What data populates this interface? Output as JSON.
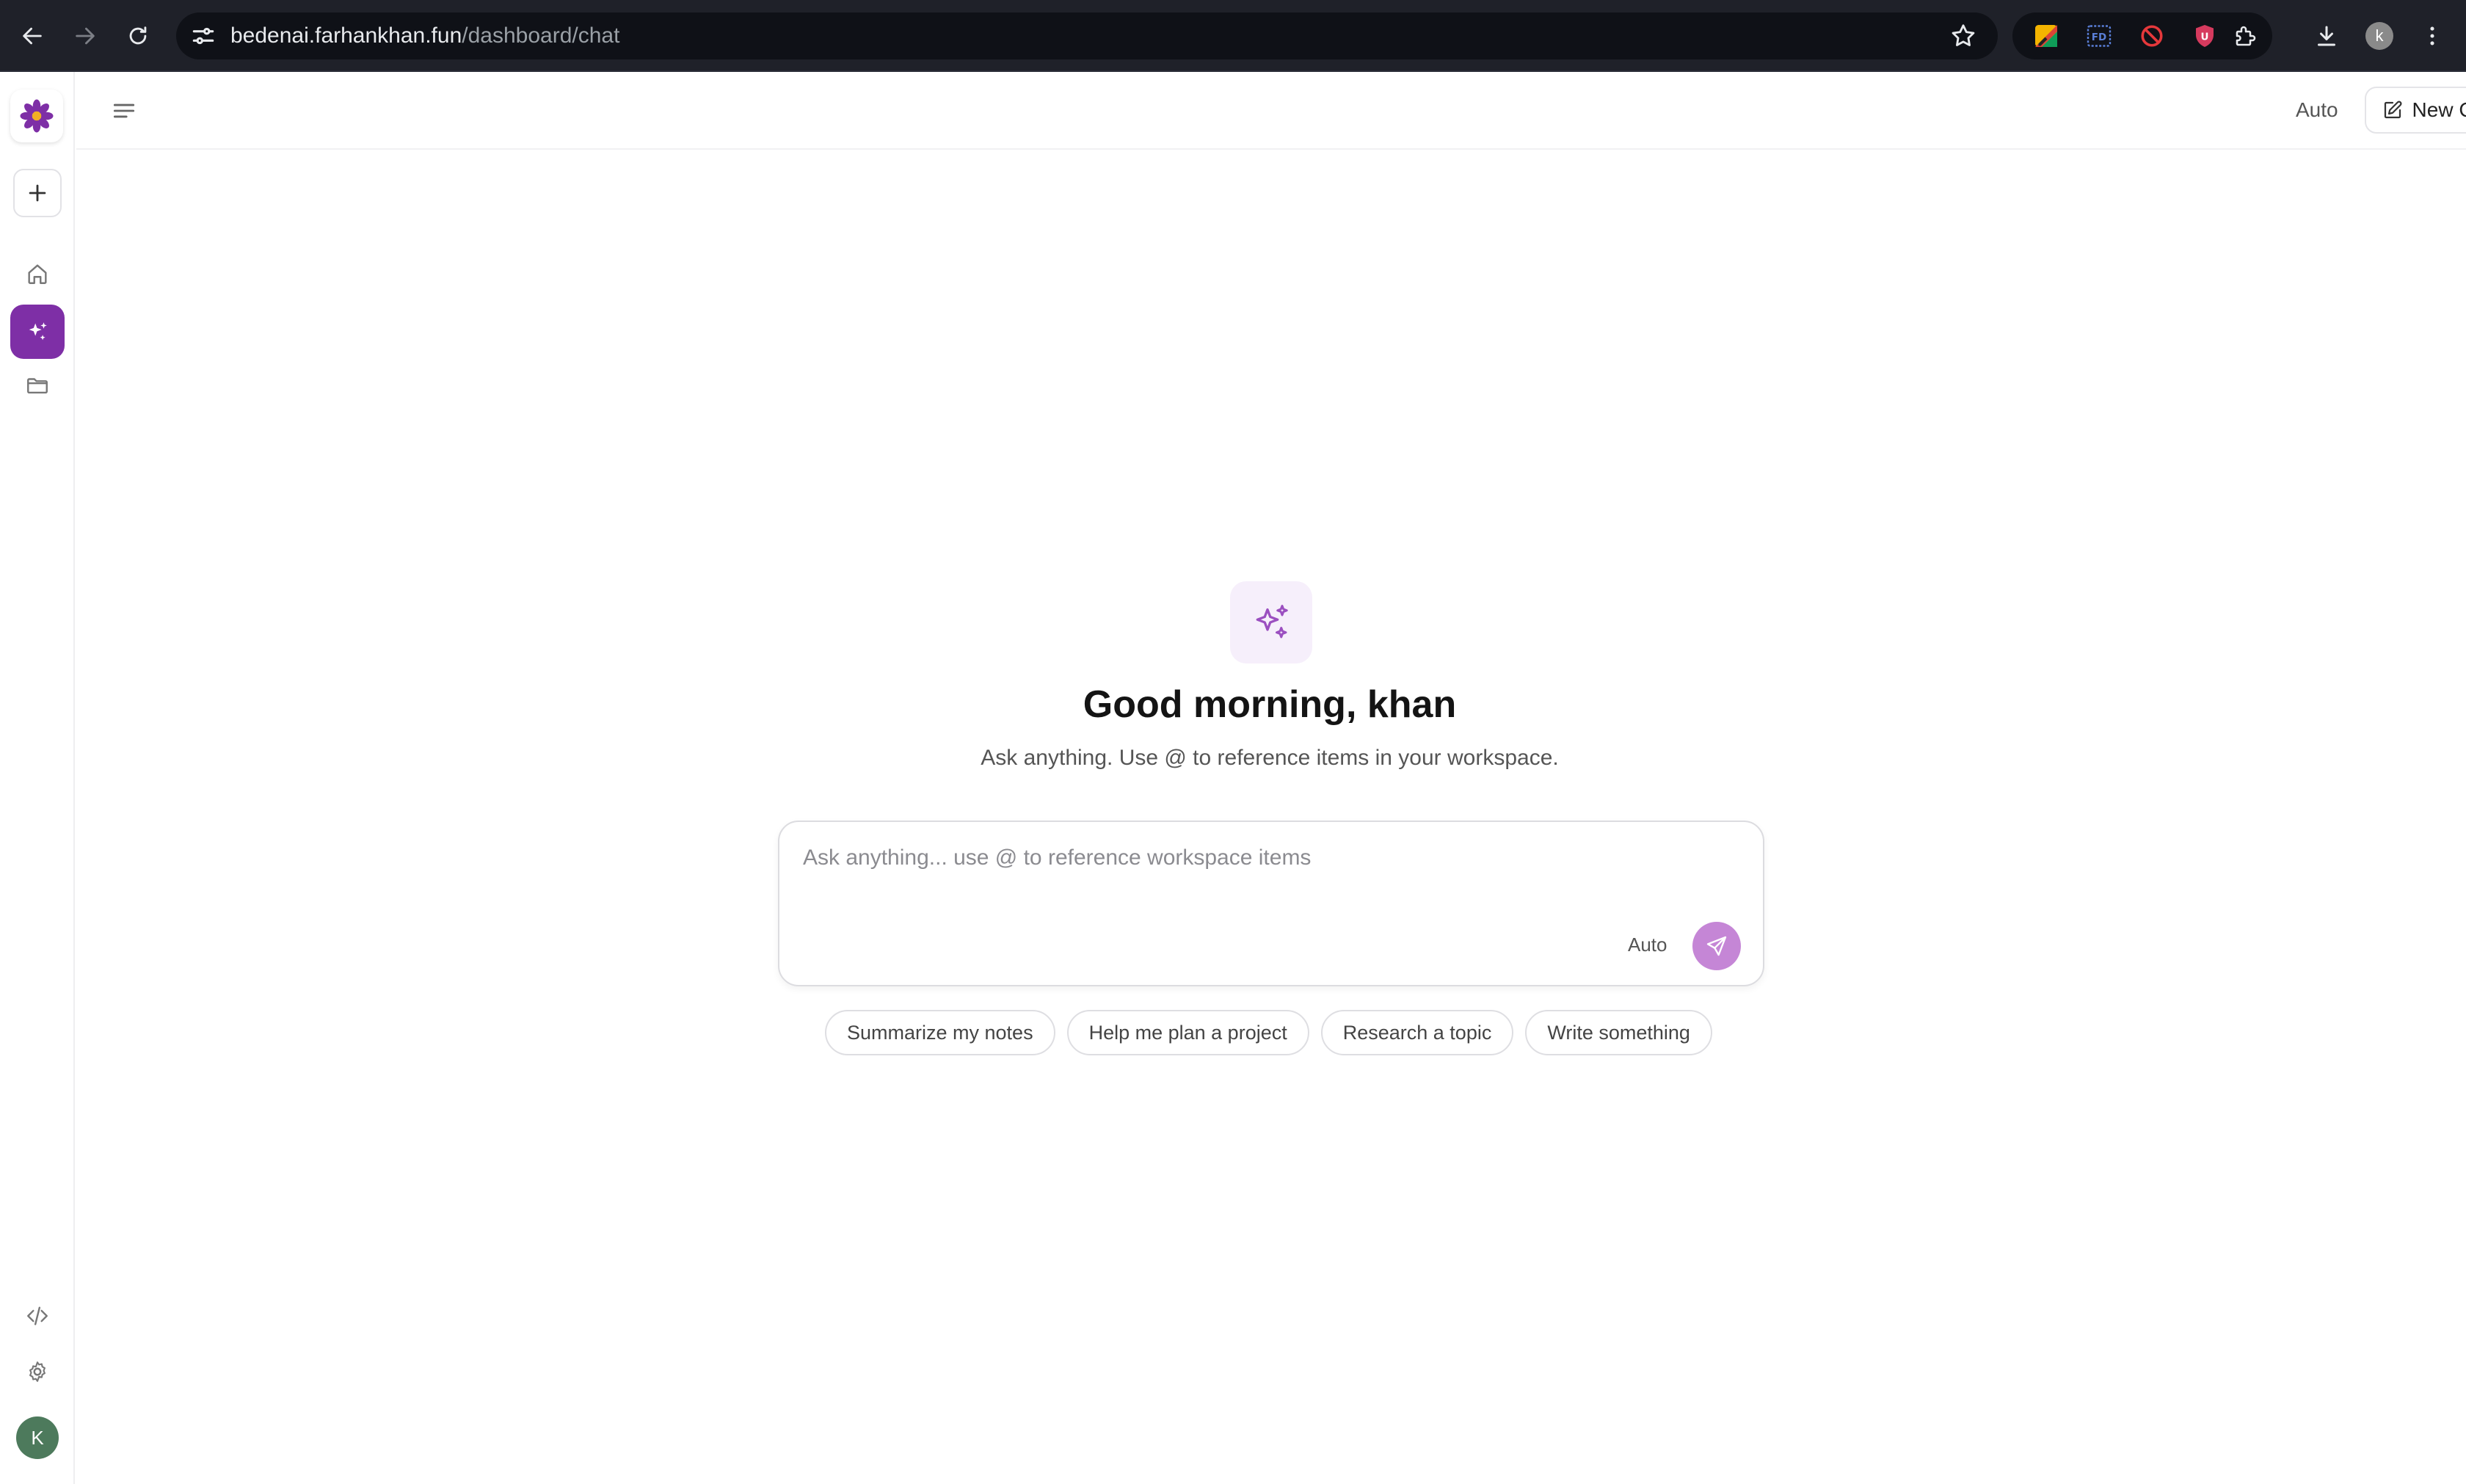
{
  "browser": {
    "url_host": "bedenai.farhankhan.fun",
    "url_path": "/dashboard/chat",
    "profile_initial": "k"
  },
  "sidebar": {
    "avatar_initial": "K",
    "accent_color": "#7e2fa6"
  },
  "header": {
    "model_label": "Auto",
    "new_chat_label": "New Chat"
  },
  "main": {
    "greeting": "Good morning, khan",
    "subtitle": "Ask anything. Use @ to reference items in your workspace.",
    "input_placeholder": "Ask anything... use @ to reference workspace items",
    "input_model_label": "Auto",
    "suggestions": [
      "Summarize my notes",
      "Help me plan a project",
      "Research a topic",
      "Write something"
    ]
  }
}
